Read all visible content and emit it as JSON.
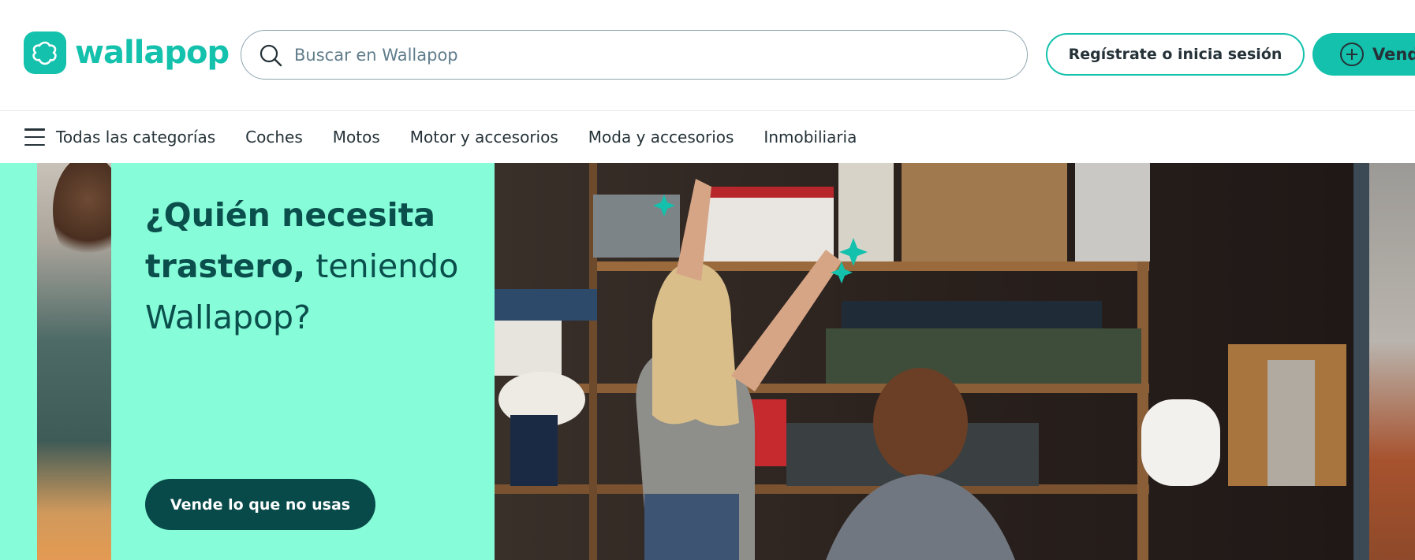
{
  "header": {
    "logo_text": "wallapop",
    "search": {
      "placeholder": "Buscar en Wallapop"
    },
    "login_label": "Regístrate o inicia sesión",
    "sell_label": "Vend"
  },
  "nav": {
    "all_categories": "Todas las categorías",
    "items": [
      "Coches",
      "Motos",
      "Motor y accesorios",
      "Moda y accesorios",
      "Inmobiliaria"
    ]
  },
  "hero": {
    "title_bold_1": "¿Quién necesita",
    "title_bold_2": "trastero,",
    "title_regular_2": " teniendo",
    "title_regular_3": "Wallapop?",
    "cta": "Vende lo que no usas"
  },
  "colors": {
    "brand": "#13c1ac",
    "hero_bg": "#86fcd8",
    "cta_bg": "#074a49",
    "text": "#253238"
  },
  "icons": [
    "wallapop-logo-icon",
    "search-icon",
    "plus-circle-icon",
    "menu-icon",
    "sparkle-icon"
  ]
}
